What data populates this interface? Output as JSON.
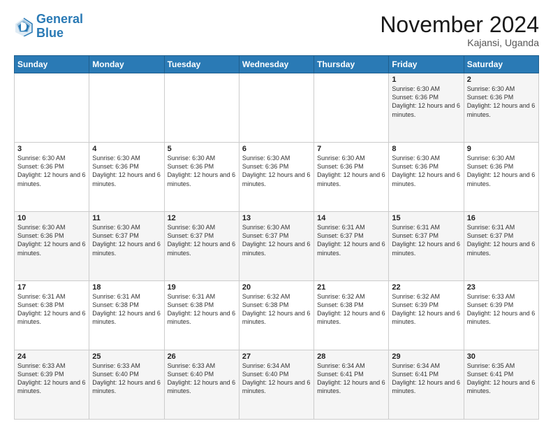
{
  "logo": {
    "line1": "General",
    "line2": "Blue"
  },
  "title": "November 2024",
  "subtitle": "Kajansi, Uganda",
  "days_header": [
    "Sunday",
    "Monday",
    "Tuesday",
    "Wednesday",
    "Thursday",
    "Friday",
    "Saturday"
  ],
  "weeks": [
    [
      {
        "num": "",
        "detail": ""
      },
      {
        "num": "",
        "detail": ""
      },
      {
        "num": "",
        "detail": ""
      },
      {
        "num": "",
        "detail": ""
      },
      {
        "num": "",
        "detail": ""
      },
      {
        "num": "1",
        "detail": "Sunrise: 6:30 AM\nSunset: 6:36 PM\nDaylight: 12 hours\nand 6 minutes."
      },
      {
        "num": "2",
        "detail": "Sunrise: 6:30 AM\nSunset: 6:36 PM\nDaylight: 12 hours\nand 6 minutes."
      }
    ],
    [
      {
        "num": "3",
        "detail": "Sunrise: 6:30 AM\nSunset: 6:36 PM\nDaylight: 12 hours\nand 6 minutes."
      },
      {
        "num": "4",
        "detail": "Sunrise: 6:30 AM\nSunset: 6:36 PM\nDaylight: 12 hours\nand 6 minutes."
      },
      {
        "num": "5",
        "detail": "Sunrise: 6:30 AM\nSunset: 6:36 PM\nDaylight: 12 hours\nand 6 minutes."
      },
      {
        "num": "6",
        "detail": "Sunrise: 6:30 AM\nSunset: 6:36 PM\nDaylight: 12 hours\nand 6 minutes."
      },
      {
        "num": "7",
        "detail": "Sunrise: 6:30 AM\nSunset: 6:36 PM\nDaylight: 12 hours\nand 6 minutes."
      },
      {
        "num": "8",
        "detail": "Sunrise: 6:30 AM\nSunset: 6:36 PM\nDaylight: 12 hours\nand 6 minutes."
      },
      {
        "num": "9",
        "detail": "Sunrise: 6:30 AM\nSunset: 6:36 PM\nDaylight: 12 hours\nand 6 minutes."
      }
    ],
    [
      {
        "num": "10",
        "detail": "Sunrise: 6:30 AM\nSunset: 6:36 PM\nDaylight: 12 hours\nand 6 minutes."
      },
      {
        "num": "11",
        "detail": "Sunrise: 6:30 AM\nSunset: 6:37 PM\nDaylight: 12 hours\nand 6 minutes."
      },
      {
        "num": "12",
        "detail": "Sunrise: 6:30 AM\nSunset: 6:37 PM\nDaylight: 12 hours\nand 6 minutes."
      },
      {
        "num": "13",
        "detail": "Sunrise: 6:30 AM\nSunset: 6:37 PM\nDaylight: 12 hours\nand 6 minutes."
      },
      {
        "num": "14",
        "detail": "Sunrise: 6:31 AM\nSunset: 6:37 PM\nDaylight: 12 hours\nand 6 minutes."
      },
      {
        "num": "15",
        "detail": "Sunrise: 6:31 AM\nSunset: 6:37 PM\nDaylight: 12 hours\nand 6 minutes."
      },
      {
        "num": "16",
        "detail": "Sunrise: 6:31 AM\nSunset: 6:37 PM\nDaylight: 12 hours\nand 6 minutes."
      }
    ],
    [
      {
        "num": "17",
        "detail": "Sunrise: 6:31 AM\nSunset: 6:38 PM\nDaylight: 12 hours\nand 6 minutes."
      },
      {
        "num": "18",
        "detail": "Sunrise: 6:31 AM\nSunset: 6:38 PM\nDaylight: 12 hours\nand 6 minutes."
      },
      {
        "num": "19",
        "detail": "Sunrise: 6:31 AM\nSunset: 6:38 PM\nDaylight: 12 hours\nand 6 minutes."
      },
      {
        "num": "20",
        "detail": "Sunrise: 6:32 AM\nSunset: 6:38 PM\nDaylight: 12 hours\nand 6 minutes."
      },
      {
        "num": "21",
        "detail": "Sunrise: 6:32 AM\nSunset: 6:38 PM\nDaylight: 12 hours\nand 6 minutes."
      },
      {
        "num": "22",
        "detail": "Sunrise: 6:32 AM\nSunset: 6:39 PM\nDaylight: 12 hours\nand 6 minutes."
      },
      {
        "num": "23",
        "detail": "Sunrise: 6:33 AM\nSunset: 6:39 PM\nDaylight: 12 hours\nand 6 minutes."
      }
    ],
    [
      {
        "num": "24",
        "detail": "Sunrise: 6:33 AM\nSunset: 6:39 PM\nDaylight: 12 hours\nand 6 minutes."
      },
      {
        "num": "25",
        "detail": "Sunrise: 6:33 AM\nSunset: 6:40 PM\nDaylight: 12 hours\nand 6 minutes."
      },
      {
        "num": "26",
        "detail": "Sunrise: 6:33 AM\nSunset: 6:40 PM\nDaylight: 12 hours\nand 6 minutes."
      },
      {
        "num": "27",
        "detail": "Sunrise: 6:34 AM\nSunset: 6:40 PM\nDaylight: 12 hours\nand 6 minutes."
      },
      {
        "num": "28",
        "detail": "Sunrise: 6:34 AM\nSunset: 6:41 PM\nDaylight: 12 hours\nand 6 minutes."
      },
      {
        "num": "29",
        "detail": "Sunrise: 6:34 AM\nSunset: 6:41 PM\nDaylight: 12 hours\nand 6 minutes."
      },
      {
        "num": "30",
        "detail": "Sunrise: 6:35 AM\nSunset: 6:41 PM\nDaylight: 12 hours\nand 6 minutes."
      }
    ]
  ]
}
